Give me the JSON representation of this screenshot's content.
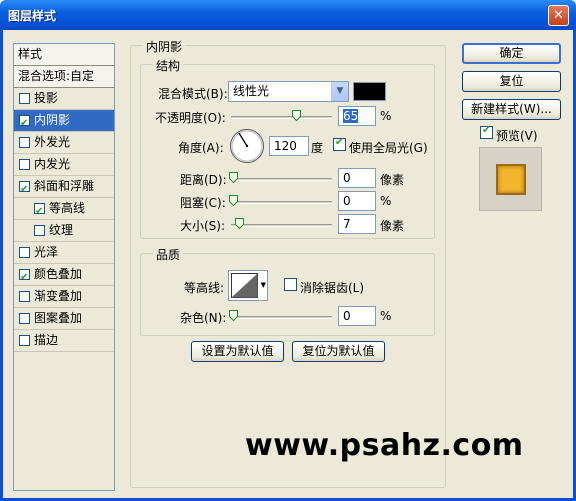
{
  "window": {
    "title": "图层样式",
    "close_glyph": "✕"
  },
  "stylelist": {
    "header": "样式",
    "blend_options": "混合选项:自定",
    "items": [
      {
        "label": "投影",
        "checked": false,
        "selected": false,
        "sub": false
      },
      {
        "label": "内阴影",
        "checked": true,
        "selected": true,
        "sub": false
      },
      {
        "label": "外发光",
        "checked": false,
        "selected": false,
        "sub": false
      },
      {
        "label": "内发光",
        "checked": false,
        "selected": false,
        "sub": false
      },
      {
        "label": "斜面和浮雕",
        "checked": true,
        "selected": false,
        "sub": false
      },
      {
        "label": "等高线",
        "checked": true,
        "selected": false,
        "sub": true
      },
      {
        "label": "纹理",
        "checked": false,
        "selected": false,
        "sub": true
      },
      {
        "label": "光泽",
        "checked": false,
        "selected": false,
        "sub": false
      },
      {
        "label": "颜色叠加",
        "checked": true,
        "selected": false,
        "sub": false
      },
      {
        "label": "渐变叠加",
        "checked": false,
        "selected": false,
        "sub": false
      },
      {
        "label": "图案叠加",
        "checked": false,
        "selected": false,
        "sub": false
      },
      {
        "label": "描边",
        "checked": false,
        "selected": false,
        "sub": false
      }
    ]
  },
  "inner_shadow": {
    "group_title": "内阴影",
    "structure": {
      "title": "结构",
      "blend_mode_label": "混合模式(B):",
      "blend_mode_value": "线性光",
      "blend_color": "#000000",
      "opacity_label": "不透明度(O):",
      "opacity_value": "65",
      "opacity_unit": "%",
      "angle_label": "角度(A):",
      "angle_value": "120",
      "angle_unit": "度",
      "global_light_label": "使用全局光(G)",
      "global_light_checked": true,
      "distance_label": "距离(D):",
      "distance_value": "0",
      "distance_unit": "像素",
      "choke_label": "阻塞(C):",
      "choke_value": "0",
      "choke_unit": "%",
      "size_label": "大小(S):",
      "size_value": "7",
      "size_unit": "像素"
    },
    "quality": {
      "title": "品质",
      "contour_label": "等高线:",
      "anti_alias_label": "消除锯齿(L)",
      "anti_alias_checked": false,
      "noise_label": "杂色(N):",
      "noise_value": "0",
      "noise_unit": "%"
    },
    "make_default": "设置为默认值",
    "reset_default": "复位为默认值"
  },
  "buttons": {
    "ok": "确定",
    "reset": "复位",
    "new_style": "新建样式(W)...",
    "preview_label": "预览(V)",
    "preview_checked": true
  },
  "watermark": "www.psahz.com",
  "colors": {
    "title_bar": "#0a5fe0",
    "selection": "#316ac5",
    "preview_swatch": "#f0b62c"
  }
}
